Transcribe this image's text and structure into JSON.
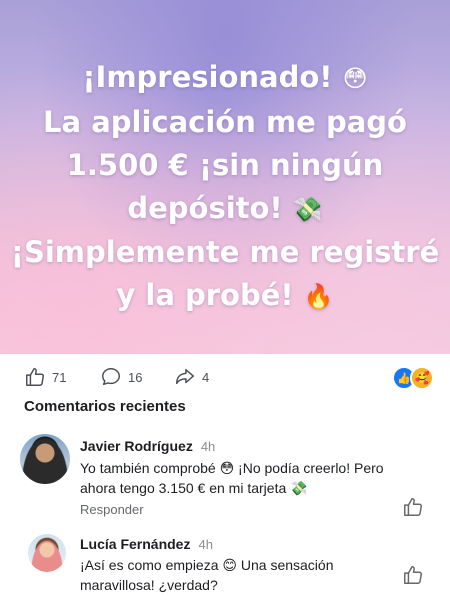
{
  "hero": {
    "line1": "¡Impresionado!",
    "line1_emoji": "😳",
    "line2": "La aplicación me pagó",
    "line3": "1.500 € ¡sin ningún",
    "line4": "depósito!",
    "line4_emoji": "💸",
    "line5": "¡Simplemente me registré",
    "line6": "y la probé!",
    "line6_emoji": "🔥"
  },
  "stats": {
    "likes": "71",
    "comments": "16",
    "shares": "4",
    "reaction_like_icon": "👍",
    "reaction_care_icon": "🥰"
  },
  "comments_section": {
    "title": "Comentarios recientes",
    "comments": [
      {
        "name": "Javier Rodríguez",
        "time": "4h",
        "text": "Yo también comprobé 😳 ¡No podía creerlo! Pero ahora tengo 3.150 € en mi tarjeta 💸",
        "reply_label": "Responder"
      },
      {
        "name": "Lucía Fernández",
        "time": "4h",
        "text": "¡Así es como empieza 😊 Una sensación maravillosa! ¿verdad?"
      }
    ]
  },
  "icons": {
    "like": "thumbs-up-icon",
    "comment": "comment-bubble-icon",
    "share": "share-arrow-icon"
  },
  "colors": {
    "like_blue": "#1877f2",
    "care_yellow": "#f7b125",
    "muted": "#65676b"
  }
}
